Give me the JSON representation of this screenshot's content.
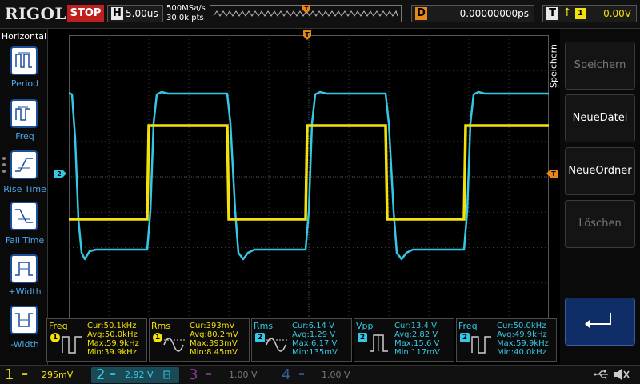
{
  "header": {
    "logo": "RIGOL",
    "run_state": "STOP",
    "timebase_letter": "H",
    "timebase": "5.00us",
    "sample_rate": "500MSa/s",
    "memory_depth": "30.0k pts",
    "delay_letter": "D",
    "delay": "0.00000000ps",
    "trigger_letter": "T",
    "trigger_edge": "↑",
    "trigger_source": "1",
    "trigger_level": "0.00V"
  },
  "left_menu": {
    "title": "Horizontal",
    "items": [
      {
        "label": "Period",
        "icon": "period-icon"
      },
      {
        "label": "Freq",
        "icon": "frequency-icon"
      },
      {
        "label": "Rise Time",
        "icon": "rise-time-icon"
      },
      {
        "label": "Fall Time",
        "icon": "fall-time-icon"
      },
      {
        "label": "+Width",
        "icon": "positive-width-icon"
      },
      {
        "label": "-Width",
        "icon": "negative-width-icon"
      }
    ]
  },
  "right_menu": {
    "title": "Speichern",
    "buttons": [
      {
        "label": "Speichern",
        "enabled": false
      },
      {
        "label": "NeueDatei",
        "enabled": true
      },
      {
        "label": "NeueOrdner",
        "enabled": true
      },
      {
        "label": "Löschen",
        "enabled": false
      }
    ],
    "enter_icon": "enter-arrow-icon"
  },
  "markers": {
    "ch2": "2",
    "trigger_pos": "T",
    "trigger_level": "T"
  },
  "measurements": [
    {
      "name": "Freq",
      "ch": "1",
      "icon": "frequency-icon",
      "cur": "Cur:50.1kHz",
      "avg": "Avg:50.0kHz",
      "max": "Max:59.9kHz",
      "min": "Min:39.9kHz"
    },
    {
      "name": "Rms",
      "ch": "1",
      "icon": "rms-icon",
      "cur": "Cur:393mV",
      "avg": "Avg:80.2mV",
      "max": "Max:393mV",
      "min": "Min:8.45mV"
    },
    {
      "name": "Rms",
      "ch": "2",
      "icon": "rms-icon",
      "cur": "Cur:6.14 V",
      "avg": "Avg:1.29 V",
      "max": "Max:6.17 V",
      "min": "Min:135mV"
    },
    {
      "name": "Vpp",
      "ch": "2",
      "icon": "vpp-icon",
      "cur": "Cur:13.4 V",
      "avg": "Avg:2.82 V",
      "max": "Max:15.6 V",
      "min": "Min:117mV"
    },
    {
      "name": "Freq",
      "ch": "2",
      "icon": "frequency-icon",
      "cur": "Cur:50.0kHz",
      "avg": "Avg:49.9kHz",
      "max": "Max:59.9kHz",
      "min": "Min:40.0kHz"
    }
  ],
  "channels": [
    {
      "num": "1",
      "coupling": "═",
      "scale": "295mV",
      "color": "#f2e10c",
      "active": true
    },
    {
      "num": "2",
      "coupling": "═",
      "scale": "2.92 V",
      "color": "#35c8e6",
      "active": true
    },
    {
      "num": "3",
      "coupling": "═",
      "scale": "1.00 V",
      "color": "#8a3a8a",
      "active": false
    },
    {
      "num": "4",
      "coupling": "═",
      "scale": "1.00 V",
      "color": "#3a5a9a",
      "active": false
    }
  ],
  "colors": {
    "ch1": "#f2e10c",
    "ch2": "#35c8e6",
    "trigger": "#e9861a",
    "stop": "#c0201d"
  }
}
